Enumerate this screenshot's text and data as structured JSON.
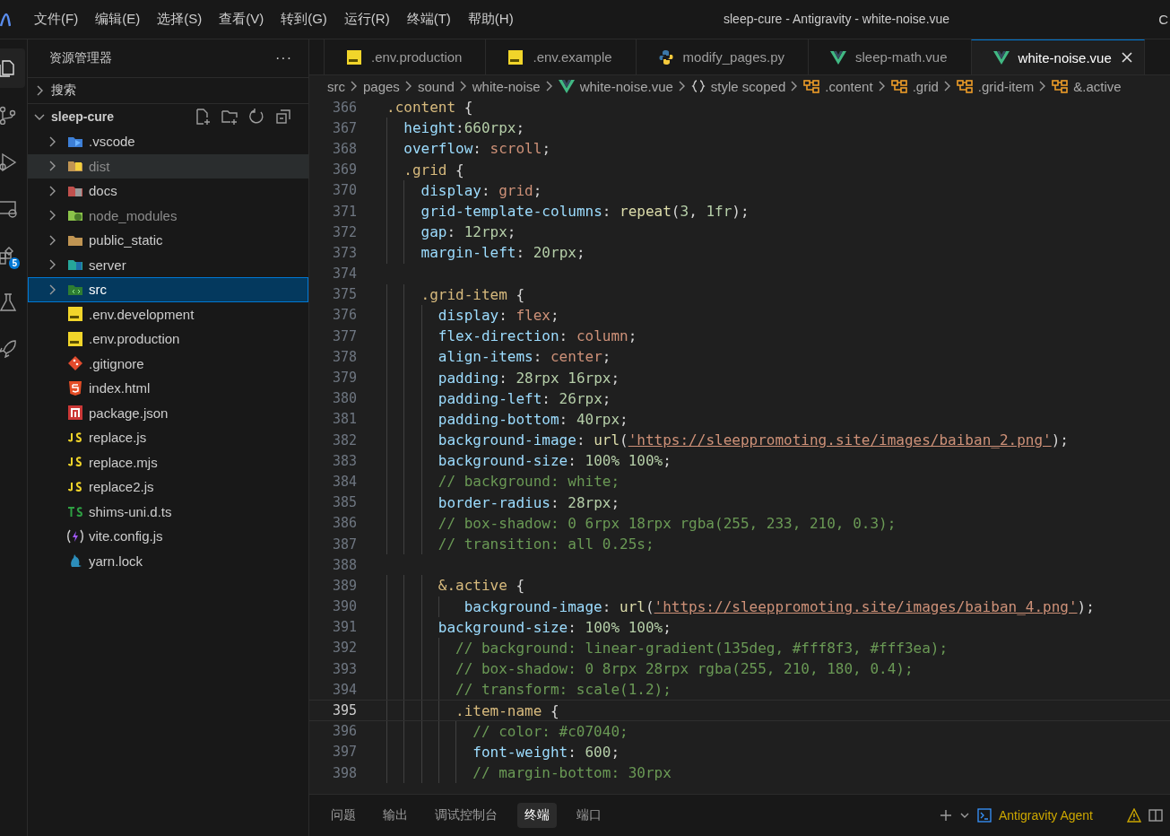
{
  "title_bar": {
    "menu": [
      "文件(F)",
      "编辑(E)",
      "选择(S)",
      "查看(V)",
      "转到(G)",
      "运行(R)",
      "终端(T)",
      "帮助(H)"
    ],
    "title": "sleep-cure - Antigravity - white-noise.vue",
    "edge_text": "C"
  },
  "activity_bar": [
    {
      "kind": "files",
      "selected": true
    },
    {
      "kind": "source-control",
      "selected": false
    },
    {
      "kind": "run",
      "selected": false
    },
    {
      "kind": "remote",
      "selected": false
    },
    {
      "kind": "extensions",
      "selected": false,
      "badge": "5"
    },
    {
      "kind": "flask",
      "selected": false
    },
    {
      "kind": "rocket",
      "selected": false
    }
  ],
  "sidebar": {
    "title": "资源管理器",
    "more": "···",
    "search_section": "搜索",
    "root": {
      "label": "sleep-cure",
      "expanded": true
    },
    "items": [
      {
        "label": ".vscode",
        "kind": "vscode",
        "folder": true,
        "dimmed": false,
        "hovered": false,
        "selected": false
      },
      {
        "label": "dist",
        "kind": "dist",
        "folder": true,
        "dimmed": true,
        "hovered": true,
        "selected": false
      },
      {
        "label": "docs",
        "kind": "docs",
        "folder": true,
        "dimmed": false,
        "hovered": false,
        "selected": false
      },
      {
        "label": "node_modules",
        "kind": "node",
        "folder": true,
        "dimmed": true,
        "hovered": false,
        "selected": false
      },
      {
        "label": "public_static",
        "kind": "folder",
        "folder": true,
        "dimmed": false,
        "hovered": false,
        "selected": false
      },
      {
        "label": "server",
        "kind": "server",
        "folder": true,
        "dimmed": false,
        "hovered": false,
        "selected": false
      },
      {
        "label": "src",
        "kind": "src",
        "folder": true,
        "dimmed": false,
        "hovered": false,
        "selected": true
      },
      {
        "label": ".env.development",
        "kind": "env",
        "folder": false,
        "dimmed": false,
        "hovered": false,
        "selected": false
      },
      {
        "label": ".env.production",
        "kind": "env",
        "folder": false,
        "dimmed": false,
        "hovered": false,
        "selected": false
      },
      {
        "label": ".gitignore",
        "kind": "git",
        "folder": false,
        "dimmed": false,
        "hovered": false,
        "selected": false
      },
      {
        "label": "index.html",
        "kind": "html",
        "folder": false,
        "dimmed": false,
        "hovered": false,
        "selected": false
      },
      {
        "label": "package.json",
        "kind": "npm",
        "folder": false,
        "dimmed": false,
        "hovered": false,
        "selected": false
      },
      {
        "label": "replace.js",
        "kind": "js",
        "folder": false,
        "dimmed": false,
        "hovered": false,
        "selected": false
      },
      {
        "label": "replace.mjs",
        "kind": "js",
        "folder": false,
        "dimmed": false,
        "hovered": false,
        "selected": false
      },
      {
        "label": "replace2.js",
        "kind": "js",
        "folder": false,
        "dimmed": false,
        "hovered": false,
        "selected": false
      },
      {
        "label": "shims-uni.d.ts",
        "kind": "ts",
        "folder": false,
        "dimmed": false,
        "hovered": false,
        "selected": false
      },
      {
        "label": "vite.config.js",
        "kind": "vite",
        "folder": false,
        "dimmed": false,
        "hovered": false,
        "selected": false
      },
      {
        "label": "yarn.lock",
        "kind": "yarn",
        "folder": false,
        "dimmed": false,
        "hovered": false,
        "selected": false
      }
    ]
  },
  "tabs": [
    {
      "label": ".env.production",
      "kind": "env",
      "selected": false
    },
    {
      "label": ".env.example",
      "kind": "env",
      "selected": false
    },
    {
      "label": "modify_pages.py",
      "kind": "python",
      "selected": false
    },
    {
      "label": "sleep-math.vue",
      "kind": "vue",
      "selected": false
    },
    {
      "label": "white-noise.vue",
      "kind": "vue",
      "selected": true
    }
  ],
  "breadcrumb": [
    {
      "label": "src",
      "kind": "folder"
    },
    {
      "label": "pages",
      "kind": "folder"
    },
    {
      "label": "sound",
      "kind": "folder"
    },
    {
      "label": "white-noise",
      "kind": "folder"
    },
    {
      "label": "white-noise.vue",
      "kind": "vue"
    },
    {
      "label": "style scoped",
      "kind": "braces"
    },
    {
      "label": ".content",
      "kind": "symbol"
    },
    {
      "label": ".grid",
      "kind": "symbol"
    },
    {
      "label": ".grid-item",
      "kind": "symbol"
    },
    {
      "label": "&.active",
      "kind": "symbol"
    }
  ],
  "code": [
    {
      "number": "366",
      "current": false,
      "tokens": [
        {
          "kind": "sel",
          "text": ".content"
        },
        {
          "kind": "punc",
          "text": " {"
        }
      ]
    },
    {
      "number": "367",
      "current": false,
      "tokens": [
        {
          "kind": "prop",
          "text": "  height"
        },
        {
          "kind": "punc",
          "text": ":"
        },
        {
          "kind": "num",
          "text": "660rpx"
        },
        {
          "kind": "punc",
          "text": ";"
        }
      ]
    },
    {
      "number": "368",
      "current": false,
      "tokens": [
        {
          "kind": "prop",
          "text": "  overflow"
        },
        {
          "kind": "punc",
          "text": ": "
        },
        {
          "kind": "val",
          "text": "scroll"
        },
        {
          "kind": "punc",
          "text": ";"
        }
      ]
    },
    {
      "number": "369",
      "current": false,
      "tokens": [
        {
          "kind": "sel",
          "text": "  .grid"
        },
        {
          "kind": "punc",
          "text": " {"
        }
      ]
    },
    {
      "number": "370",
      "current": false,
      "tokens": [
        {
          "kind": "prop",
          "text": "    display"
        },
        {
          "kind": "punc",
          "text": ": "
        },
        {
          "kind": "val",
          "text": "grid"
        },
        {
          "kind": "punc",
          "text": ";"
        }
      ]
    },
    {
      "number": "371",
      "current": false,
      "tokens": [
        {
          "kind": "prop",
          "text": "    grid-template-columns"
        },
        {
          "kind": "punc",
          "text": ": "
        },
        {
          "kind": "fn",
          "text": "repeat"
        },
        {
          "kind": "punc",
          "text": "("
        },
        {
          "kind": "num",
          "text": "3"
        },
        {
          "kind": "punc",
          "text": ", "
        },
        {
          "kind": "num",
          "text": "1fr"
        },
        {
          "kind": "punc",
          "text": ");"
        }
      ]
    },
    {
      "number": "372",
      "current": false,
      "tokens": [
        {
          "kind": "prop",
          "text": "    gap"
        },
        {
          "kind": "punc",
          "text": ": "
        },
        {
          "kind": "num",
          "text": "12rpx"
        },
        {
          "kind": "punc",
          "text": ";"
        }
      ]
    },
    {
      "number": "373",
      "current": false,
      "tokens": [
        {
          "kind": "prop",
          "text": "    margin-left"
        },
        {
          "kind": "punc",
          "text": ": "
        },
        {
          "kind": "num",
          "text": "20rpx"
        },
        {
          "kind": "punc",
          "text": ";"
        }
      ]
    },
    {
      "number": "374",
      "current": false
    },
    {
      "number": "375",
      "current": false,
      "tokens": [
        {
          "kind": "sel",
          "text": "    .grid-item"
        },
        {
          "kind": "punc",
          "text": " {"
        }
      ]
    },
    {
      "number": "376",
      "current": false,
      "tokens": [
        {
          "kind": "prop",
          "text": "      display"
        },
        {
          "kind": "punc",
          "text": ": "
        },
        {
          "kind": "val",
          "text": "flex"
        },
        {
          "kind": "punc",
          "text": ";"
        }
      ]
    },
    {
      "number": "377",
      "current": false,
      "tokens": [
        {
          "kind": "prop",
          "text": "      flex-direction"
        },
        {
          "kind": "punc",
          "text": ": "
        },
        {
          "kind": "val",
          "text": "column"
        },
        {
          "kind": "punc",
          "text": ";"
        }
      ]
    },
    {
      "number": "378",
      "current": false,
      "tokens": [
        {
          "kind": "prop",
          "text": "      align-items"
        },
        {
          "kind": "punc",
          "text": ": "
        },
        {
          "kind": "val",
          "text": "center"
        },
        {
          "kind": "punc",
          "text": ";"
        }
      ]
    },
    {
      "number": "379",
      "current": false,
      "tokens": [
        {
          "kind": "prop",
          "text": "      padding"
        },
        {
          "kind": "punc",
          "text": ": "
        },
        {
          "kind": "num",
          "text": "28rpx 16rpx"
        },
        {
          "kind": "punc",
          "text": ";"
        }
      ]
    },
    {
      "number": "380",
      "current": false,
      "tokens": [
        {
          "kind": "prop",
          "text": "      padding-left"
        },
        {
          "kind": "punc",
          "text": ": "
        },
        {
          "kind": "num",
          "text": "26rpx"
        },
        {
          "kind": "punc",
          "text": ";"
        }
      ]
    },
    {
      "number": "381",
      "current": false,
      "tokens": [
        {
          "kind": "prop",
          "text": "      padding-bottom"
        },
        {
          "kind": "punc",
          "text": ": "
        },
        {
          "kind": "num",
          "text": "40rpx"
        },
        {
          "kind": "punc",
          "text": ";"
        }
      ]
    },
    {
      "number": "382",
      "current": false,
      "tokens": [
        {
          "kind": "prop",
          "text": "      background-image"
        },
        {
          "kind": "punc",
          "text": ": "
        },
        {
          "kind": "fn",
          "text": "url"
        },
        {
          "kind": "punc",
          "text": "("
        },
        {
          "kind": "str",
          "text": "'https://sleeppromoting.site/images/baiban_2.png'"
        },
        {
          "kind": "punc",
          "text": ");"
        }
      ]
    },
    {
      "number": "383",
      "current": false,
      "tokens": [
        {
          "kind": "prop",
          "text": "      background-size"
        },
        {
          "kind": "punc",
          "text": ": "
        },
        {
          "kind": "num",
          "text": "100% 100%"
        },
        {
          "kind": "punc",
          "text": ";"
        }
      ]
    },
    {
      "number": "384",
      "current": false,
      "tokens": [
        {
          "kind": "cmt",
          "text": "      // background: white;"
        }
      ]
    },
    {
      "number": "385",
      "current": false,
      "tokens": [
        {
          "kind": "prop",
          "text": "      border-radius"
        },
        {
          "kind": "punc",
          "text": ": "
        },
        {
          "kind": "num",
          "text": "28rpx"
        },
        {
          "kind": "punc",
          "text": ";"
        }
      ]
    },
    {
      "number": "386",
      "current": false,
      "tokens": [
        {
          "kind": "cmt",
          "text": "      // box-shadow: 0 6rpx 18rpx rgba(255, 233, 210, 0.3);"
        }
      ]
    },
    {
      "number": "387",
      "current": false,
      "tokens": [
        {
          "kind": "cmt",
          "text": "      // transition: all 0.25s;"
        }
      ]
    },
    {
      "number": "388",
      "current": false
    },
    {
      "number": "389",
      "current": false,
      "tokens": [
        {
          "kind": "amp",
          "text": "      &"
        },
        {
          "kind": "sel",
          "text": ".active"
        },
        {
          "kind": "punc",
          "text": " {"
        }
      ]
    },
    {
      "number": "390",
      "current": false,
      "tokens": [
        {
          "kind": "prop",
          "text": "         background-image"
        },
        {
          "kind": "punc",
          "text": ": "
        },
        {
          "kind": "fn",
          "text": "url"
        },
        {
          "kind": "punc",
          "text": "("
        },
        {
          "kind": "str",
          "text": "'https://sleeppromoting.site/images/baiban_4.png'"
        },
        {
          "kind": "punc",
          "text": ");"
        }
      ]
    },
    {
      "number": "391",
      "current": false,
      "tokens": [
        {
          "kind": "prop",
          "text": "      background-size"
        },
        {
          "kind": "punc",
          "text": ": "
        },
        {
          "kind": "num",
          "text": "100% 100%"
        },
        {
          "kind": "punc",
          "text": ";"
        }
      ]
    },
    {
      "number": "392",
      "current": false,
      "tokens": [
        {
          "kind": "cmt",
          "text": "        // background: linear-gradient(135deg, #fff8f3, #fff3ea);"
        }
      ]
    },
    {
      "number": "393",
      "current": false,
      "tokens": [
        {
          "kind": "cmt",
          "text": "        // box-shadow: 0 8rpx 28rpx rgba(255, 210, 180, 0.4);"
        }
      ]
    },
    {
      "number": "394",
      "current": false,
      "tokens": [
        {
          "kind": "cmt",
          "text": "        // transform: scale(1.2);"
        }
      ]
    },
    {
      "number": "395",
      "current": true,
      "tokens": [
        {
          "kind": "sel",
          "text": "        .item-name"
        },
        {
          "kind": "punc",
          "text": " {"
        }
      ]
    },
    {
      "number": "396",
      "current": false,
      "tokens": [
        {
          "kind": "cmt",
          "text": "          // color: #c07040;"
        }
      ]
    },
    {
      "number": "397",
      "current": false,
      "tokens": [
        {
          "kind": "prop",
          "text": "          font-weight"
        },
        {
          "kind": "punc",
          "text": ": "
        },
        {
          "kind": "num",
          "text": "600"
        },
        {
          "kind": "punc",
          "text": ";"
        }
      ]
    },
    {
      "number": "398",
      "current": false,
      "tokens": [
        {
          "kind": "cmt",
          "text": "          // margin-bottom: 30rpx"
        }
      ]
    }
  ],
  "panel": {
    "tabs": [
      {
        "label": "问题",
        "selected": false
      },
      {
        "label": "输出",
        "selected": false
      },
      {
        "label": "调试控制台",
        "selected": false
      },
      {
        "label": "终端",
        "selected": true
      },
      {
        "label": "端口",
        "selected": false
      }
    ],
    "agent": "Antigravity Agent"
  }
}
